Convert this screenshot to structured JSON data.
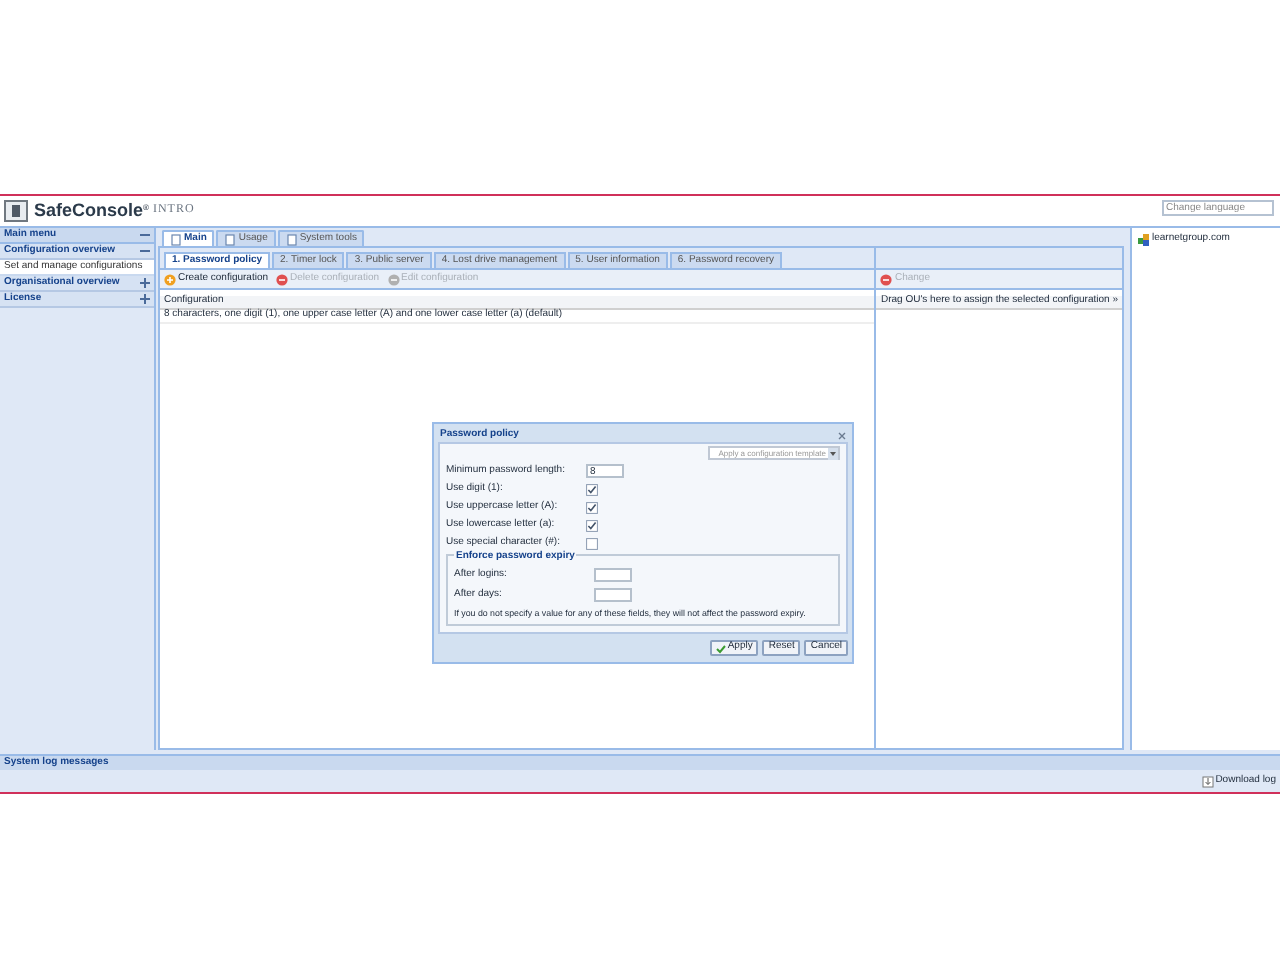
{
  "header": {
    "logo_name": "SafeConsole",
    "logo_mark": "®",
    "edition": "INTRO",
    "language_field": {
      "placeholder": "Change language"
    }
  },
  "sidebar": {
    "title": "Main menu",
    "sections": [
      {
        "label": "Configuration overview",
        "expanded": true,
        "items": [
          {
            "label": "Set and manage configurations",
            "selected": true
          }
        ]
      },
      {
        "label": "Organisational overview",
        "expanded": false
      },
      {
        "label": "License",
        "expanded": false
      }
    ]
  },
  "main_tabs": [
    {
      "label": "Main",
      "selected": true
    },
    {
      "label": "Usage",
      "selected": false
    },
    {
      "label": "System tools",
      "selected": false
    }
  ],
  "config_tabs": [
    {
      "label": "1. Password policy",
      "selected": true
    },
    {
      "label": "2. Timer lock",
      "selected": false
    },
    {
      "label": "3. Public server",
      "selected": false
    },
    {
      "label": "4. Lost drive management",
      "selected": false
    },
    {
      "label": "5. User information",
      "selected": false
    },
    {
      "label": "6. Password recovery",
      "selected": false
    }
  ],
  "toolbar": [
    {
      "kind": "create",
      "label": "Create configuration",
      "disabled": false
    },
    {
      "kind": "delete",
      "label": "Delete configuration",
      "disabled": true
    },
    {
      "kind": "edit",
      "label": "Edit configuration",
      "disabled": true
    }
  ],
  "grid": {
    "columns": [
      "Configuration"
    ],
    "rows": [
      {
        "cells": [
          "8 characters, one digit (1), one upper case letter (A) and one lower case letter (a) (default)"
        ],
        "selected": false
      }
    ]
  },
  "assign_panel": {
    "button": {
      "label": "Change",
      "disabled": true
    },
    "header": "Drag OU's here to assign the selected configuration »"
  },
  "tree": [
    {
      "label": "learnetgroup.com"
    }
  ],
  "dialog": {
    "title": "Password policy",
    "template_field": {
      "placeholder": "Apply a configuration template"
    },
    "fields": [
      {
        "kind": "text",
        "label": "Minimum password length:",
        "value": "8"
      },
      {
        "kind": "checkbox",
        "label": "Use digit (1):",
        "checked": true
      },
      {
        "kind": "checkbox",
        "label": "Use uppercase letter (A):",
        "checked": true
      },
      {
        "kind": "checkbox",
        "label": "Use lowercase letter (a):",
        "checked": true
      },
      {
        "kind": "checkbox",
        "label": "Use special character (#):",
        "checked": false
      }
    ],
    "expiry": {
      "legend": "Enforce password expiry",
      "fields": [
        {
          "label": "After logins:"
        },
        {
          "label": "After days:"
        }
      ],
      "note": "If you do not specify a value for any of these fields, they will not affect the password expiry."
    },
    "buttons": [
      {
        "kind": "apply",
        "label": "Apply"
      },
      {
        "kind": "plain",
        "label": "Reset"
      },
      {
        "kind": "plain",
        "label": "Cancel"
      }
    ]
  },
  "footer": {
    "log_title": "System log messages",
    "download": "Download log"
  }
}
